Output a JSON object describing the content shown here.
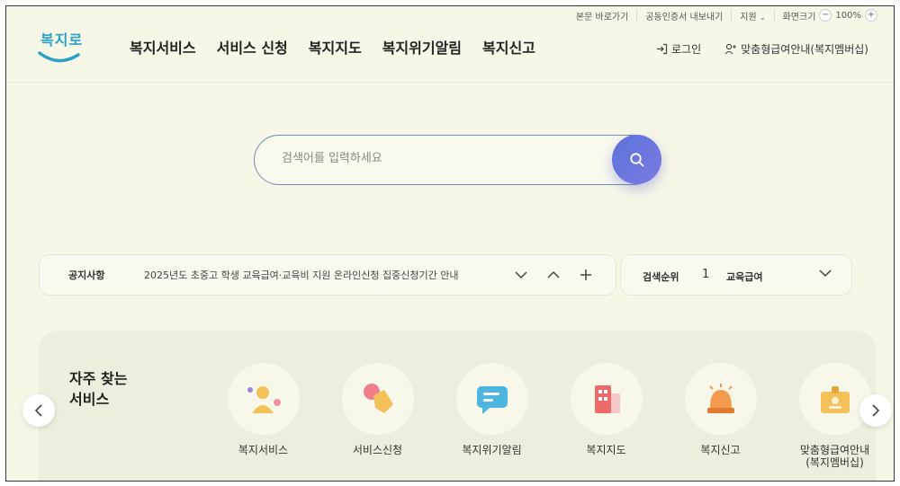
{
  "utility": {
    "skip": "본문 바로가기",
    "cert": "공동인증서 내보내기",
    "support": "지원",
    "zoom_label": "화면크기",
    "zoom_minus": "−",
    "zoom_value": "100%",
    "zoom_plus": "+"
  },
  "logo": {
    "text": "복지로"
  },
  "gnb": [
    "복지서비스",
    "서비스 신청",
    "복지지도",
    "복지위기알림",
    "복지신고"
  ],
  "header": {
    "login": "로그인",
    "guide": "맞춤형급여안내(복지멤버십)"
  },
  "search": {
    "placeholder": "검색어를 입력하세요"
  },
  "notice": {
    "label": "공지사항",
    "text": "2025년도 초중고 학생 교육급여·교육비 지원 온라인신청 집중신청기간 안내"
  },
  "ranking": {
    "label": "검색순위",
    "rank": "1",
    "keyword": "교육급여"
  },
  "services": {
    "title": "자주 찾는\n서비스",
    "items": [
      {
        "label": "복지서비스",
        "icon": "person-icon"
      },
      {
        "label": "서비스신청",
        "icon": "hand-click-icon"
      },
      {
        "label": "복지위기알림",
        "icon": "chat-icon"
      },
      {
        "label": "복지지도",
        "icon": "building-icon"
      },
      {
        "label": "복지신고",
        "icon": "siren-icon"
      },
      {
        "label": "맞춤형급여안내\n(복지멤버십)",
        "icon": "id-badge-icon"
      }
    ]
  }
}
